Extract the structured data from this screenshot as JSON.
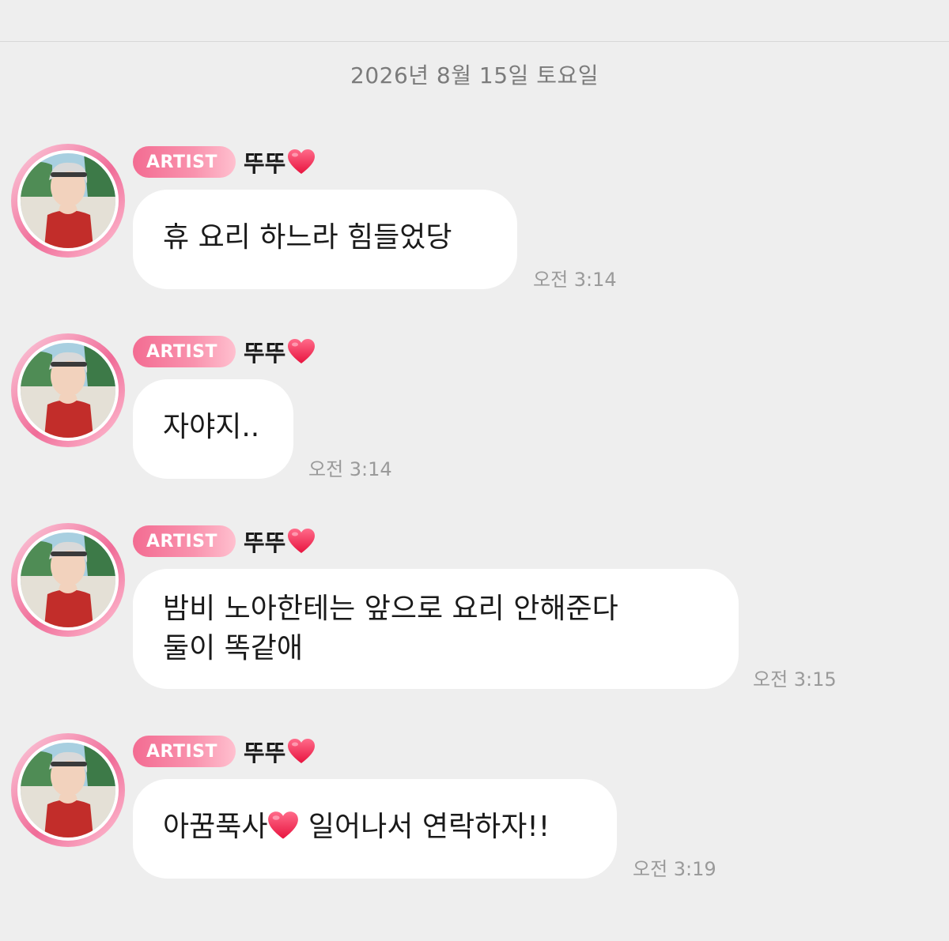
{
  "date_header": "2026년 8월 15일 토요일",
  "sender": {
    "badge": "ARTIST",
    "name": "뚜뚜",
    "avatar_icon": "profile-avatar",
    "heart_color": "#f0244f"
  },
  "messages": [
    {
      "text": "휴 요리 하느라 힘들었당",
      "time": "오전 3:14"
    },
    {
      "text": "자야지..",
      "time": "오전 3:14"
    },
    {
      "line1": "밤비 노아한테는 앞으로 요리 안해준다",
      "line2": "둘이 똑같애",
      "time": "오전 3:15"
    },
    {
      "text_before": "아꿈푹사",
      "text_after": " 일어나서 연락하자!!",
      "time": "오전 3:19"
    }
  ],
  "colors": {
    "background": "#eeeeee",
    "bubble": "#ffffff",
    "badge_start": "#f36c92",
    "badge_end": "#ffc0cf",
    "timestamp": "#9a9a9a"
  }
}
